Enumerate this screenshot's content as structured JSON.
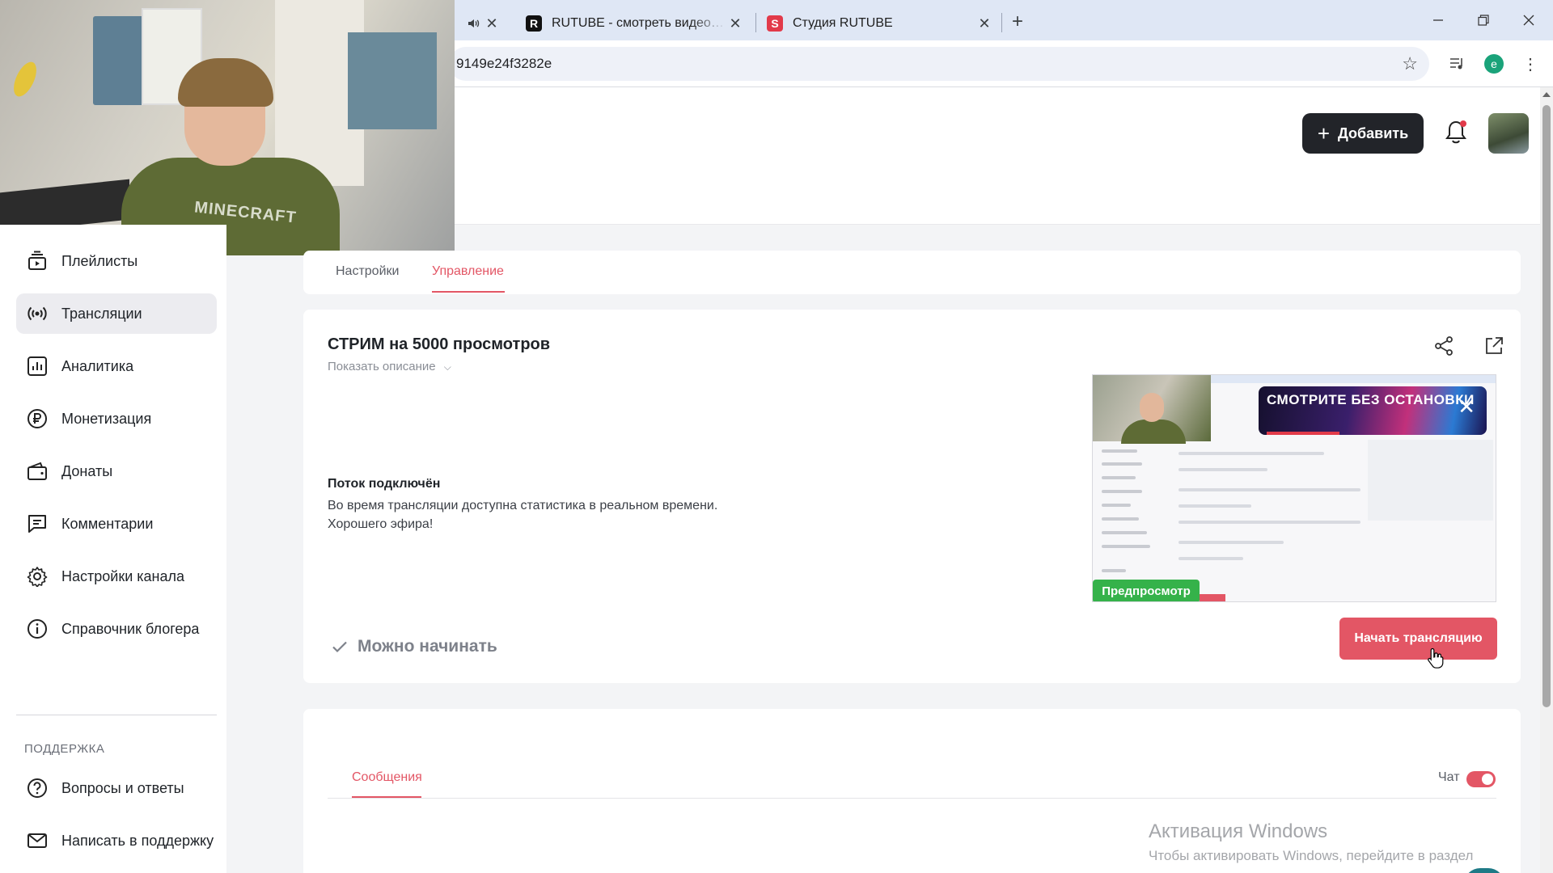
{
  "browser": {
    "tabs": [
      {
        "title": "RUTUBE - смотреть видео онлайн",
        "favicon": "R",
        "favicon_color": "#111111"
      },
      {
        "title": "Студия RUTUBE",
        "favicon": "S",
        "favicon_color": "#e23a4a"
      }
    ],
    "url": "9149e24f3282e",
    "profile_initial": "e",
    "icons": [
      "speaker-icon",
      "close-icon",
      "new-tab-icon",
      "minimize-icon",
      "restore-icon",
      "window-close-icon",
      "bookmark-star-icon",
      "media-control-icon",
      "profile-icon",
      "kebab-menu-icon"
    ]
  },
  "header": {
    "add_label": "Добавить"
  },
  "webcam": {
    "shirt_text": "MINECRAFT"
  },
  "sidebar": {
    "items": [
      {
        "label": "Плейлисты",
        "icon": "playlist-icon"
      },
      {
        "label": "Трансляции",
        "icon": "broadcast-icon",
        "active": true
      },
      {
        "label": "Аналитика",
        "icon": "analytics-icon"
      },
      {
        "label": "Монетизация",
        "icon": "ruble-icon"
      },
      {
        "label": "Донаты",
        "icon": "wallet-icon"
      },
      {
        "label": "Комментарии",
        "icon": "comment-icon"
      },
      {
        "label": "Настройки канала",
        "icon": "gear-icon"
      },
      {
        "label": "Справочник блогера",
        "icon": "info-icon"
      }
    ],
    "support_section": "ПОДДЕРЖКА",
    "support_items": [
      {
        "label": "Вопросы и ответы",
        "icon": "question-icon"
      },
      {
        "label": "Написать в поддержку",
        "icon": "mail-icon"
      }
    ]
  },
  "page_tabs": {
    "settings": "Настройки",
    "management": "Управление"
  },
  "stream": {
    "title": "СТРИМ на 5000 просмотров",
    "show_description": "Показать описание",
    "status_title": "Поток подключён",
    "status_line1": "Во время трансляции доступна статистика в реальном времени.",
    "status_line2": "Хорошего эфира!",
    "ready": "Можно начинать",
    "preview_badge": "Предпросмотр",
    "preview_ad": "СМОТРИТЕ БЕЗ ОСТАНОВКИ",
    "start_button": "Начать трансляцию"
  },
  "chat": {
    "messages_tab": "Сообщения",
    "chat_label": "Чат",
    "chat_enabled": true
  },
  "watermark": {
    "title": "Активация Windows",
    "subtitle": "Чтобы активировать Windows, перейдите в раздел"
  },
  "colors": {
    "accent": "#e35665",
    "dark_button": "#222429",
    "preview_badge": "#35b24a"
  }
}
